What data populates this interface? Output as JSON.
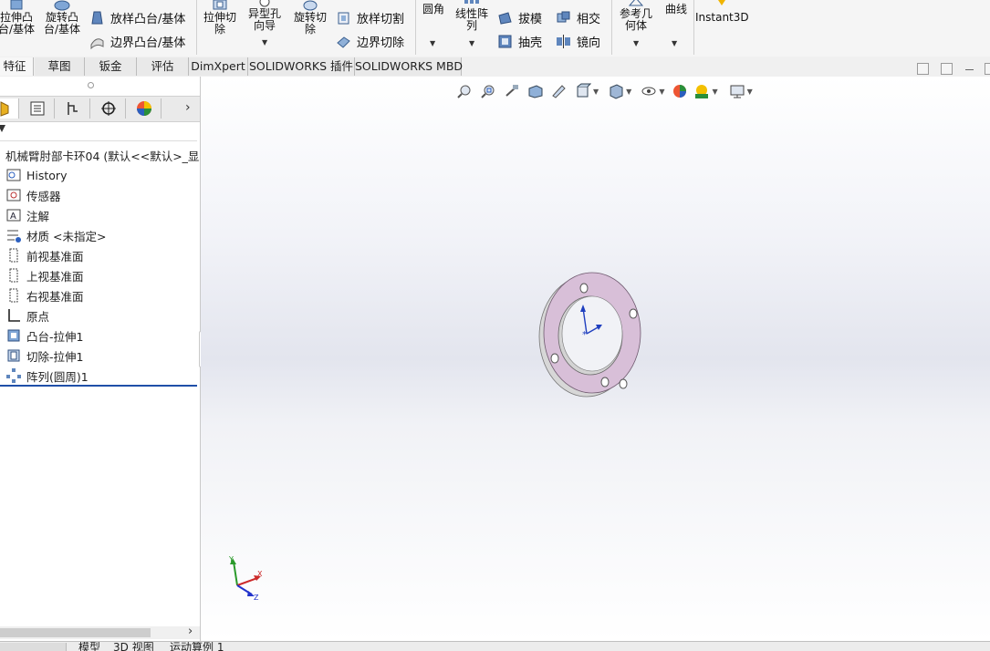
{
  "ribbon": {
    "extrude_boss": "拉伸凸\n台/基体",
    "revolve_boss": "旋转凸\n台/基体",
    "loft_boss": "放样凸台/基体",
    "boundary_boss": "边界凸台/基体",
    "extrude_cut": "拉伸切\n除",
    "hole_wizard": "异型孔\n向导",
    "revolve_cut": "旋转切\n除",
    "loft_cut": "放样切割",
    "boundary_cut": "边界切除",
    "fillet": "圆角",
    "linear_pattern": "线性阵\n列",
    "draft": "拔模",
    "intersect": "相交",
    "shell": "抽壳",
    "mirror": "镜向",
    "ref_geometry": "参考几\n何体",
    "curves": "曲线",
    "instant3d": "Instant3D"
  },
  "tabs": [
    "特征",
    "草图",
    "钣金",
    "评估",
    "DimXpert",
    "SOLIDWORKS 插件",
    "SOLIDWORKS MBD"
  ],
  "tree": {
    "root": "机械臂肘部卡环04  (默认<<默认>_显示",
    "items": [
      {
        "label": "History",
        "icon": "history-icon"
      },
      {
        "label": "传感器",
        "icon": "sensor-icon"
      },
      {
        "label": "注解",
        "icon": "annotation-icon"
      },
      {
        "label": "材质 <未指定>",
        "icon": "material-icon"
      },
      {
        "label": "前视基准面",
        "icon": "plane-icon"
      },
      {
        "label": "上视基准面",
        "icon": "plane-icon"
      },
      {
        "label": "右视基准面",
        "icon": "plane-icon"
      },
      {
        "label": "原点",
        "icon": "origin-icon"
      },
      {
        "label": "凸台-拉伸1",
        "icon": "boss-extrude-icon"
      },
      {
        "label": "切除-拉伸1",
        "icon": "cut-extrude-icon"
      },
      {
        "label": "阵列(圆周)1",
        "icon": "circular-pattern-icon"
      }
    ]
  },
  "triad": {
    "x": "X",
    "y": "Y",
    "z": "Z"
  },
  "bottom_tabs": [
    "模型",
    "3D 视图",
    "运动算例 1"
  ],
  "colors": {
    "face": "#d8bfd8",
    "accent": "#1f4fa8"
  }
}
